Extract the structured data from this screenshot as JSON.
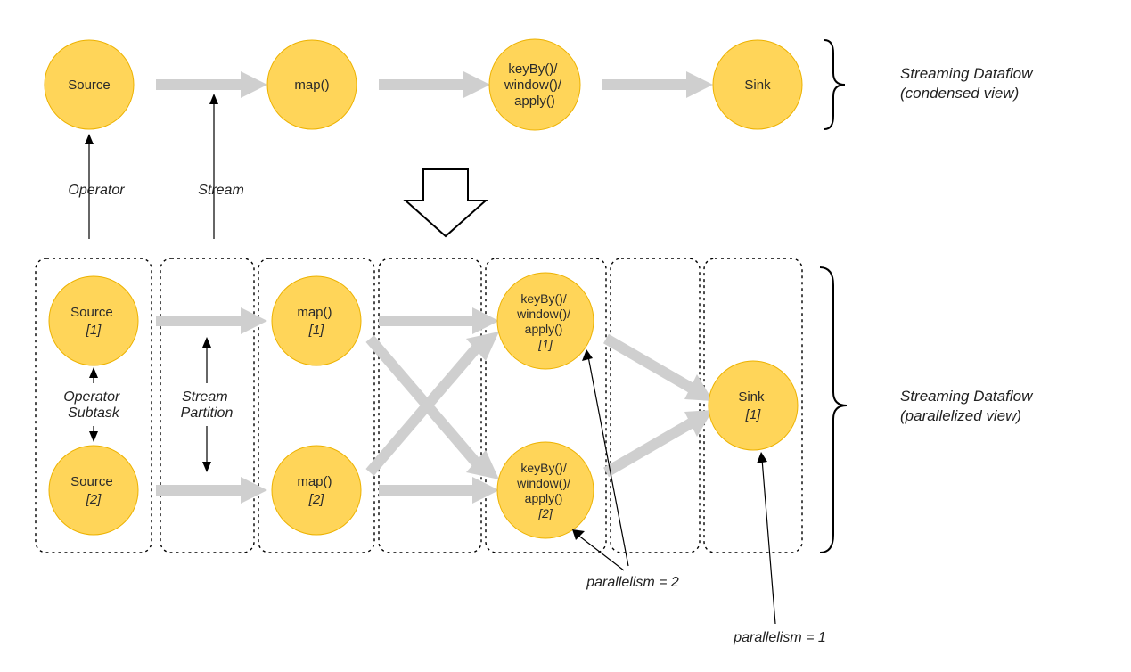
{
  "colors": {
    "nodeFill": "#ffd559",
    "nodeStroke": "#edb200",
    "flowArrow": "#cfcfcf"
  },
  "nodes": {
    "source": "Source",
    "map": "map()",
    "keyby_l1": "keyBy()/",
    "keyby_l2": "window()/",
    "keyby_l3": "apply()",
    "sink": "Sink",
    "source1_l1": "Source",
    "source1_l2": "[1]",
    "source2_l1": "Source",
    "source2_l2": "[2]",
    "map1_l1": "map()",
    "map1_l2": "[1]",
    "map2_l1": "map()",
    "map2_l2": "[2]",
    "kb1_l1": "keyBy()/",
    "kb1_l2": "window()/",
    "kb1_l3": "apply()",
    "kb1_l4": "[1]",
    "kb2_l1": "keyBy()/",
    "kb2_l2": "window()/",
    "kb2_l3": "apply()",
    "kb2_l4": "[2]",
    "sink1_l1": "Sink",
    "sink1_l2": "[1]"
  },
  "labels": {
    "operator": "Operator",
    "stream": "Stream",
    "operatorSubtask_l1": "Operator",
    "operatorSubtask_l2": "Subtask",
    "streamPartition_l1": "Stream",
    "streamPartition_l2": "Partition",
    "parallelism2": "parallelism = 2",
    "parallelism1": "parallelism = 1",
    "condensed_l1": "Streaming Dataflow",
    "condensed_l2": "(condensed view)",
    "parallel_l1": "Streaming Dataflow",
    "parallel_l2": "(parallelized view)"
  }
}
